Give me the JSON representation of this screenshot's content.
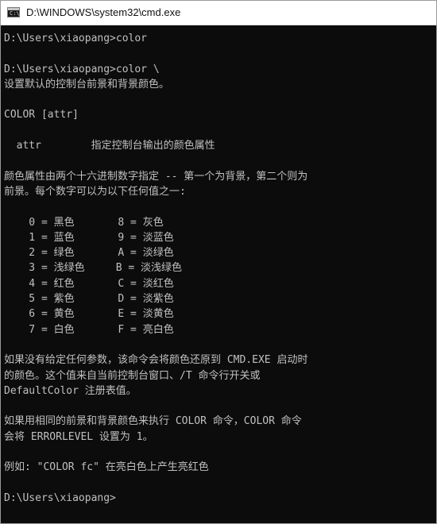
{
  "window": {
    "title": "D:\\WINDOWS\\system32\\cmd.exe",
    "icon": "cmd-icon",
    "icon_text": "C:\\",
    "background": "#0c0c0c",
    "text_color": "#c0c0c0"
  },
  "console": {
    "lines": [
      "D:\\Users\\xiaopang>color",
      "",
      "D:\\Users\\xiaopang>color \\",
      "设置默认的控制台前景和背景颜色。",
      "",
      "COLOR [attr]",
      "",
      "  attr        指定控制台输出的颜色属性",
      "",
      "颜色属性由两个十六进制数字指定 -- 第一个为背景，第二个则为",
      "前景。每个数字可以为以下任何值之一:",
      "",
      "    0 = 黑色       8 = 灰色",
      "    1 = 蓝色       9 = 淡蓝色",
      "    2 = 绿色       A = 淡绿色",
      "    3 = 浅绿色     B = 淡浅绿色",
      "    4 = 红色       C = 淡红色",
      "    5 = 紫色       D = 淡紫色",
      "    6 = 黄色       E = 淡黄色",
      "    7 = 白色       F = 亮白色",
      "",
      "如果没有给定任何参数，该命令会将颜色还原到 CMD.EXE 启动时",
      "的颜色。这个值来自当前控制台窗口、/T 命令行开关或",
      "DefaultColor 注册表值。",
      "",
      "如果用相同的前景和背景颜色来执行 COLOR 命令，COLOR 命令",
      "会将 ERRORLEVEL 设置为 1。",
      "",
      "例如: \"COLOR fc\" 在亮白色上产生亮红色",
      "",
      "D:\\Users\\xiaopang>"
    ]
  }
}
